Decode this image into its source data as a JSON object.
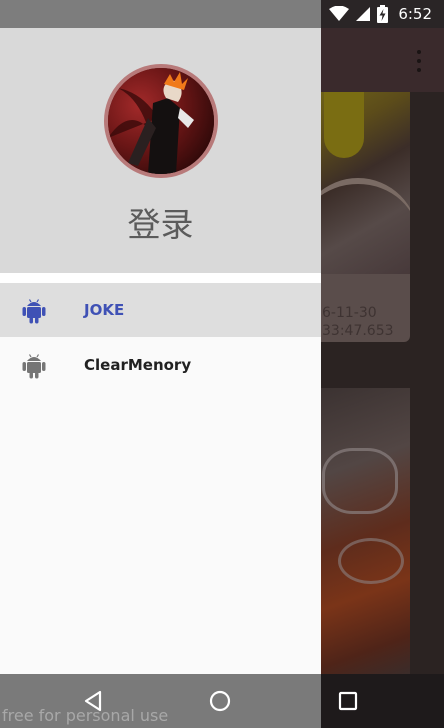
{
  "status_bar": {
    "time": "6:52",
    "icons": [
      "wifi-icon",
      "cell-signal-icon",
      "battery-charging-icon"
    ]
  },
  "background_app": {
    "overflow_icon": "more-vert-icon",
    "card": {
      "date_line": "6-11-30",
      "time_line": "33:47.653"
    }
  },
  "drawer": {
    "header": {
      "avatar": "avatar-image",
      "login_label": "登录"
    },
    "items": [
      {
        "label": "JOKE",
        "icon": "android-icon",
        "selected": true,
        "color": "#3f51b5"
      },
      {
        "label": "ClearMenory",
        "icon": "android-icon",
        "selected": false,
        "color": "#212121"
      }
    ]
  },
  "nav_bar": {
    "buttons": [
      "back-icon",
      "home-icon",
      "recents-icon"
    ]
  },
  "watermark": "free for personal use"
}
